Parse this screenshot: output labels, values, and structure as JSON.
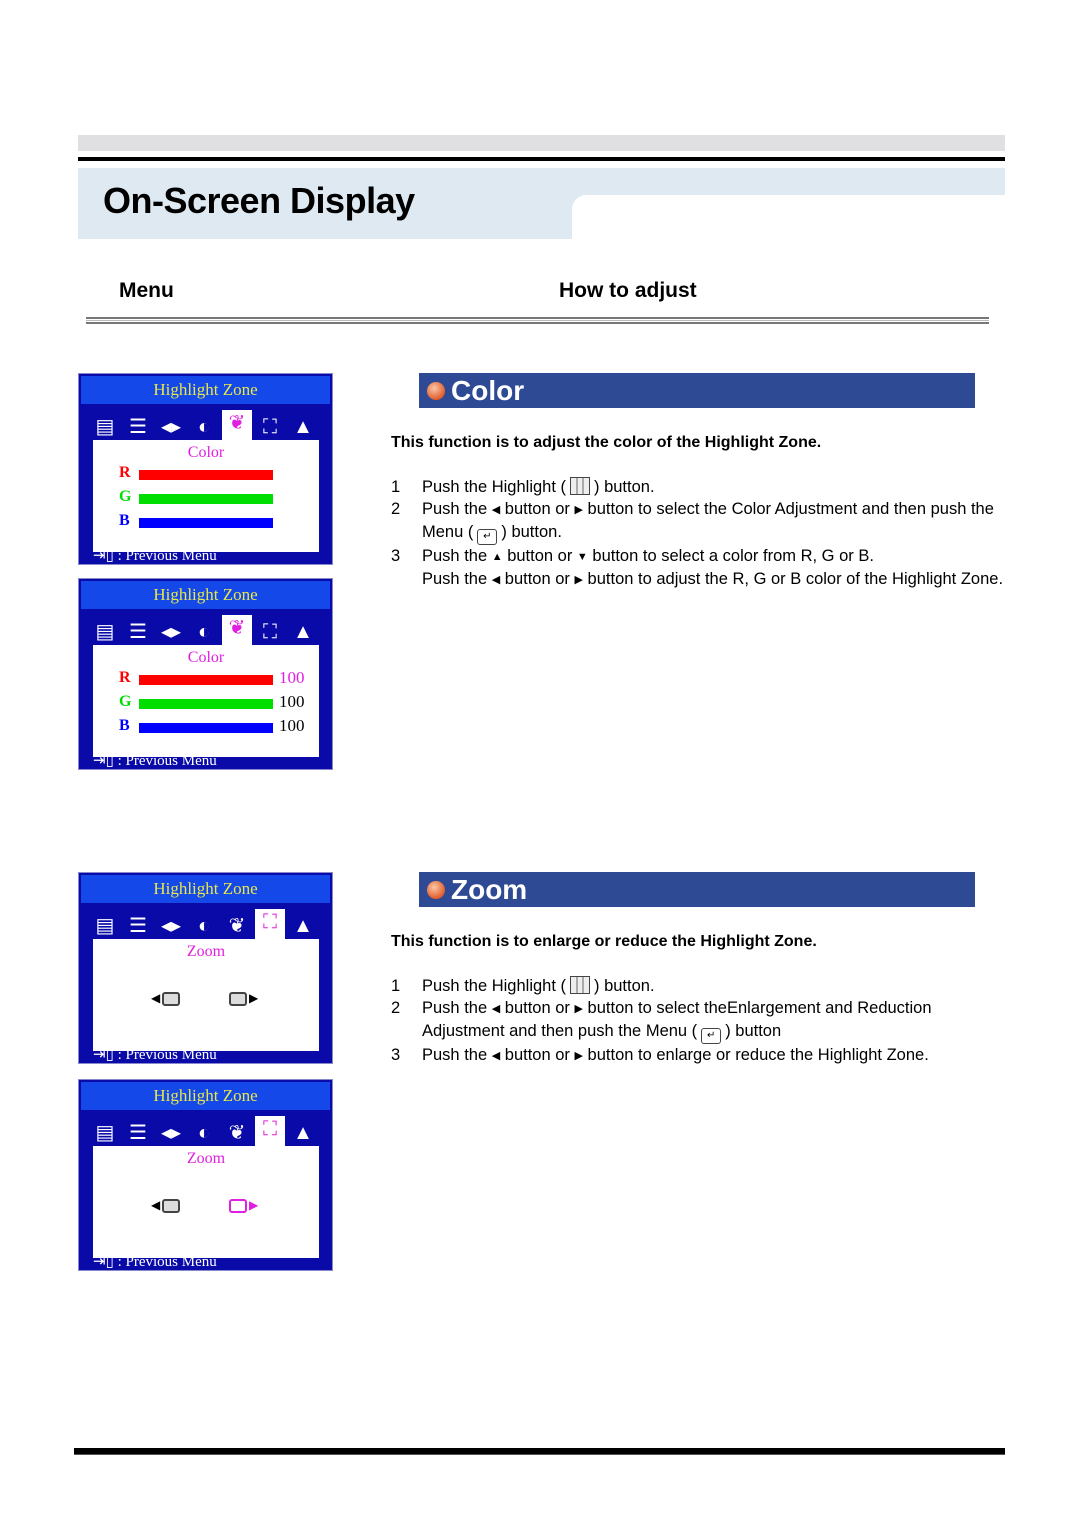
{
  "page": {
    "title": "On-Screen Display",
    "columns": {
      "menu": "Menu",
      "how_to_adjust": "How to adjust"
    }
  },
  "osd": {
    "title": "Highlight Zone",
    "footer": ": Previous Menu",
    "footer_icon": "exit-door-icon",
    "icons": [
      "brightness-icon",
      "contrast-icon",
      "sharpness-icon",
      "image-contrast-icon",
      "color-icon",
      "zoom-icon",
      "hue-icon"
    ],
    "color_screens": [
      {
        "subtitle": "Color",
        "selected_icon": "color-icon",
        "rows": [
          {
            "label": "R",
            "color": "#ff0000",
            "value": null
          },
          {
            "label": "G",
            "color": "#00dd00",
            "value": null
          },
          {
            "label": "B",
            "color": "#0000ff",
            "value": null
          }
        ]
      },
      {
        "subtitle": "Color",
        "selected_icon": "color-icon",
        "rows": [
          {
            "label": "R",
            "color": "#ff0000",
            "value": "100",
            "value_color": "#e020e0"
          },
          {
            "label": "G",
            "color": "#00dd00",
            "value": "100",
            "value_color": "#000000"
          },
          {
            "label": "B",
            "color": "#0000ff",
            "value": "100",
            "value_color": "#000000"
          }
        ]
      }
    ],
    "zoom_screens": [
      {
        "subtitle": "Zoom",
        "selected_icon": "zoom-icon",
        "active_control": "none"
      },
      {
        "subtitle": "Zoom",
        "selected_icon": "zoom-icon",
        "active_control": "enlarge"
      }
    ]
  },
  "sections": {
    "color": {
      "heading": "Color",
      "intro": "This function is to adjust the color of the Highlight Zone.",
      "steps": [
        {
          "num": "1",
          "parts": [
            "Push the Highlight (",
            ") button."
          ]
        },
        {
          "num": "2",
          "parts": [
            "Push the",
            "button or",
            "button to select the Color Adjustment and then push the Menu (",
            ") button."
          ]
        },
        {
          "num": "3",
          "parts": [
            "Push the",
            "button or",
            "button to select a color from R, G or B."
          ]
        },
        {
          "num": "",
          "parts": [
            "Push the",
            "button or",
            "button to adjust the R, G or B color of the Highlight Zone."
          ]
        }
      ]
    },
    "zoom": {
      "heading": "Zoom",
      "intro": "This function is to enlarge or reduce the Highlight Zone.",
      "steps": [
        {
          "num": "1",
          "parts": [
            "Push the Highlight (",
            ") button."
          ]
        },
        {
          "num": "2",
          "parts": [
            "Push the",
            "button or",
            "button to select theEnlargement and Reduction Adjustment and then push the Menu (",
            ") button"
          ]
        },
        {
          "num": "3",
          "parts": [
            "Push the",
            "button or",
            "button to enlarge or reduce the Highlight Zone."
          ]
        }
      ]
    }
  },
  "colors": {
    "section_header": "#2f4a94",
    "osd_bg": "#0a0aa8",
    "osd_title_bg": "#1448e8",
    "osd_title_text": "#e8e84a",
    "osd_highlight": "#e020e0",
    "title_band": "#dfe9f1"
  }
}
